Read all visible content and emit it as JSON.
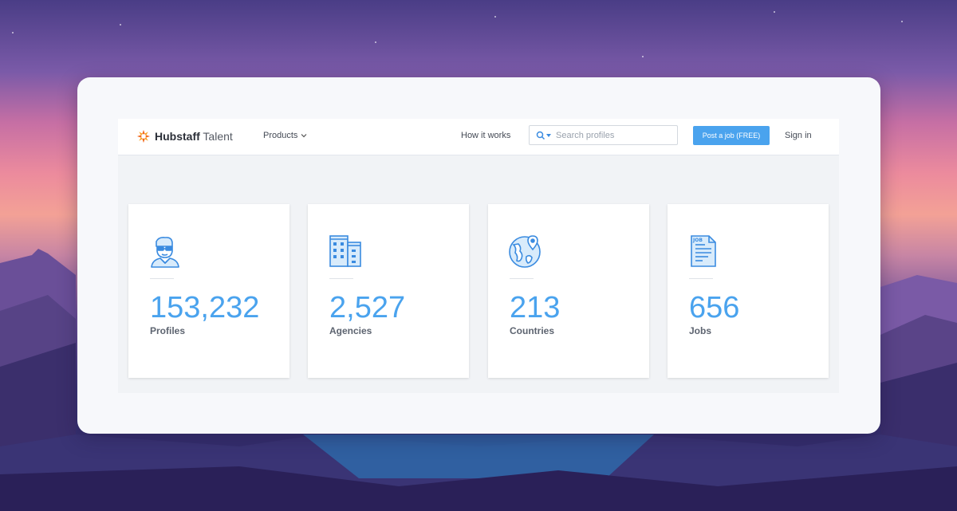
{
  "nav": {
    "brand_bold": "Hubstaff",
    "brand_light": "Talent",
    "products_label": "Products",
    "how_label": "How it works",
    "search_placeholder": "Search profiles",
    "post_job_label": "Post a job (FREE)",
    "signin_label": "Sign in"
  },
  "stats": [
    {
      "value": "153,232",
      "label": "Profiles",
      "icon": "person-icon"
    },
    {
      "value": "2,527",
      "label": "Agencies",
      "icon": "building-icon"
    },
    {
      "value": "213",
      "label": "Countries",
      "icon": "globe-icon"
    },
    {
      "value": "656",
      "label": "Jobs",
      "icon": "job-document-icon"
    }
  ],
  "colors": {
    "accent": "#4aa3ee",
    "logo_orange": "#f26b21"
  }
}
